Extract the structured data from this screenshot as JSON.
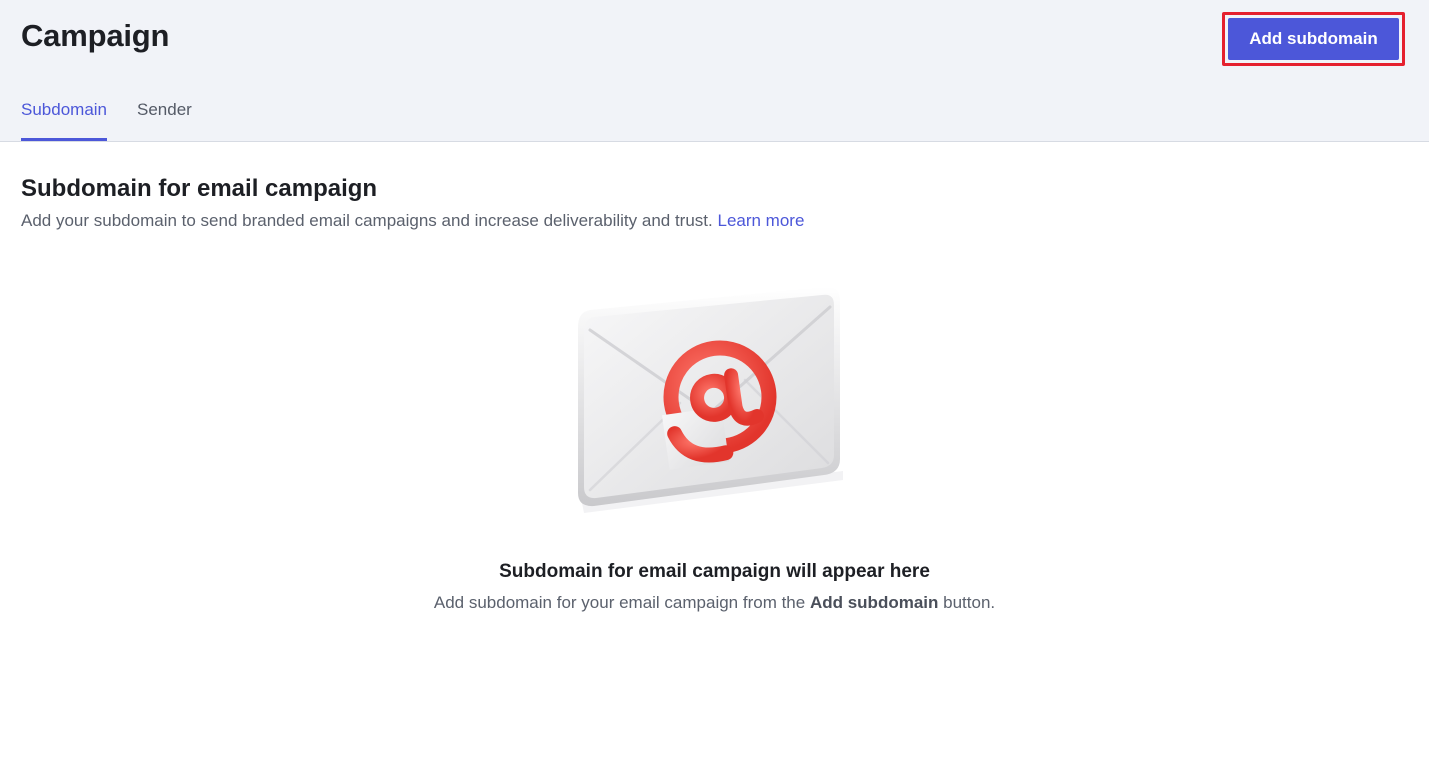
{
  "header": {
    "title": "Campaign",
    "add_button_label": "Add subdomain"
  },
  "tabs": [
    {
      "label": "Subdomain",
      "active": true
    },
    {
      "label": "Sender",
      "active": false
    }
  ],
  "section": {
    "title": "Subdomain for email campaign",
    "description": "Add your subdomain to send branded email campaigns and increase deliverability and trust.",
    "learn_more_label": "Learn more"
  },
  "empty_state": {
    "illustration": "email-envelope-at-icon",
    "title": "Subdomain for email campaign will appear here",
    "description_before": "Add subdomain for your email campaign from the",
    "description_bold": "Add subdomain",
    "description_after": "button."
  },
  "colors": {
    "accent": "#4c57d9",
    "highlight_border": "#e5202e",
    "header_bg": "#f1f3f8",
    "at_symbol": "#f0443c"
  }
}
